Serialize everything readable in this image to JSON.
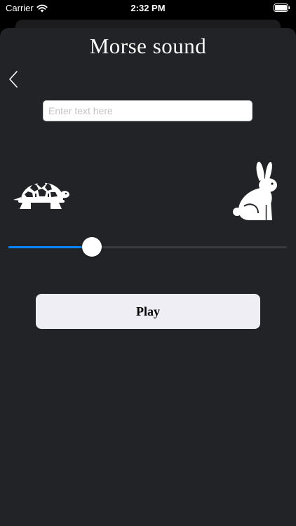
{
  "status_bar": {
    "carrier": "Carrier",
    "time": "2:32 PM",
    "wifi_icon": "wifi-icon",
    "battery_icon": "battery-icon"
  },
  "header": {
    "title": "Morse sound",
    "back_icon": "chevron-left-icon"
  },
  "input": {
    "placeholder": "Enter text here",
    "value": ""
  },
  "speed": {
    "slow_icon": "turtle-icon",
    "fast_icon": "rabbit-icon",
    "slider_value": 0.3,
    "track_color": "#3a3a3c",
    "fill_color": "#0a84ff"
  },
  "actions": {
    "play_label": "Play"
  },
  "colors": {
    "background": "#222326",
    "button_background": "#efeef4",
    "text": "#ffffff"
  }
}
